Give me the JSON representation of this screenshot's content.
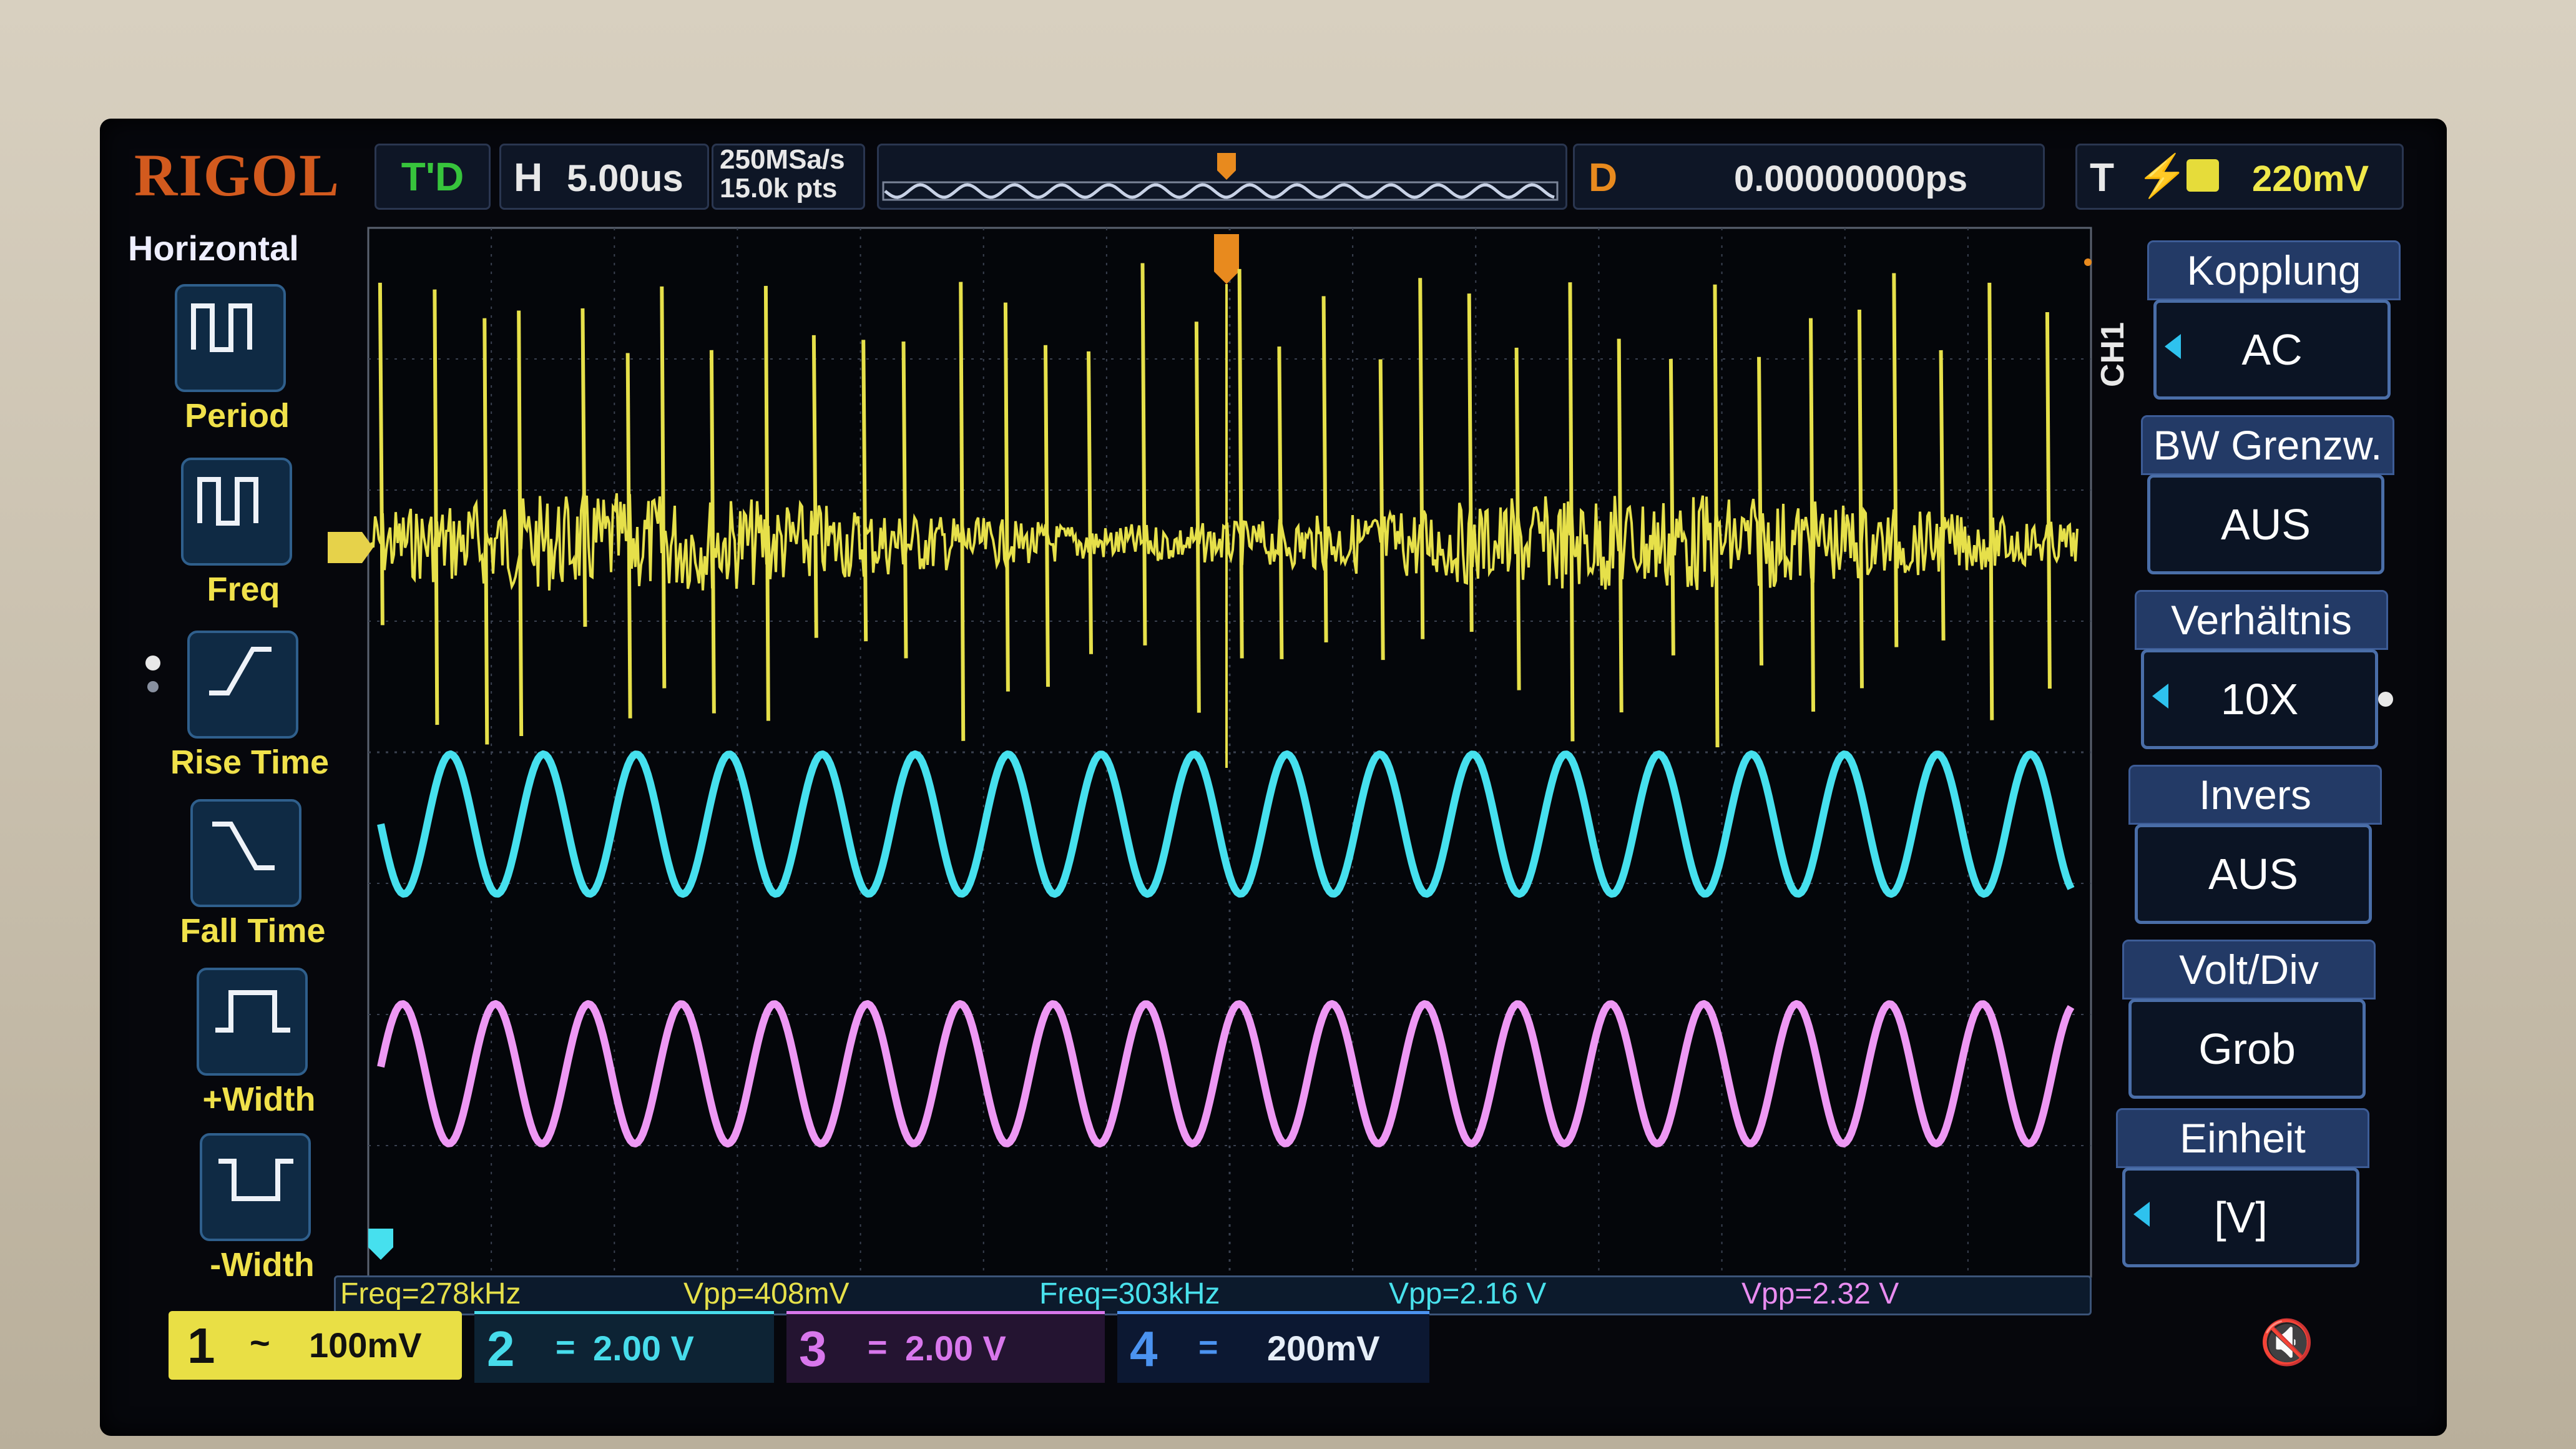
{
  "brand": "RIGOL",
  "top_bar": {
    "run_state": "T'D",
    "timebase_label": "H",
    "timebase_value": "5.00us",
    "sample_rate": "250MSa/s",
    "memory_depth": "15.0k pts",
    "delay_label": "D",
    "delay_value": "0.00000000ps",
    "trigger_label": "T",
    "trigger_edge": "rising",
    "trigger_source_ch": "1",
    "trigger_level": "220mV"
  },
  "measure_panel": {
    "title": "Horizontal",
    "items": [
      {
        "label": "Period",
        "icon": "period-icon"
      },
      {
        "label": "Freq",
        "icon": "freq-icon"
      },
      {
        "label": "Rise Time",
        "icon": "rise-time-icon"
      },
      {
        "label": "Fall Time",
        "icon": "fall-time-icon"
      },
      {
        "label": "+Width",
        "icon": "plus-width-icon"
      },
      {
        "label": "-Width",
        "icon": "minus-width-icon"
      }
    ]
  },
  "channel_menu": {
    "channel": "CH1",
    "items": [
      {
        "title": "Kopplung",
        "value": "AC"
      },
      {
        "title": "BW Grenzw.",
        "value": "AUS"
      },
      {
        "title": "Verhältnis",
        "value": "10X"
      },
      {
        "title": "Invers",
        "value": "AUS"
      },
      {
        "title": "Volt/Div",
        "value": "Grob"
      },
      {
        "title": "Einheit",
        "value": "[V]"
      }
    ]
  },
  "measurements": [
    {
      "text": "Freq=278kHz",
      "channel": 1
    },
    {
      "text": "Vpp=408mV",
      "channel": 1
    },
    {
      "text": "Freq=303kHz",
      "channel": 2
    },
    {
      "text": "Vpp=2.16 V",
      "channel": 2
    },
    {
      "text": "Vpp=2.32 V",
      "channel": 3
    }
  ],
  "channels": [
    {
      "number": "1",
      "coupling": "~",
      "scale": "100mV",
      "color": "#e9df45"
    },
    {
      "number": "2",
      "coupling": "=",
      "scale": "2.00 V",
      "color": "#47dceb"
    },
    {
      "number": "3",
      "coupling": "=",
      "scale": "2.00 V",
      "color": "#d877ec"
    },
    {
      "number": "4",
      "coupling": "=",
      "scale": "200mV",
      "color": "#4b93f0"
    }
  ],
  "colors": {
    "grid": "#3a4150",
    "ch1": "#e6e04a",
    "ch2": "#46e0ee",
    "ch3": "#ee98f4",
    "accent_menu": "#233a66",
    "brand": "#d25a1e"
  },
  "icons": {
    "mute": "mute-icon"
  }
}
